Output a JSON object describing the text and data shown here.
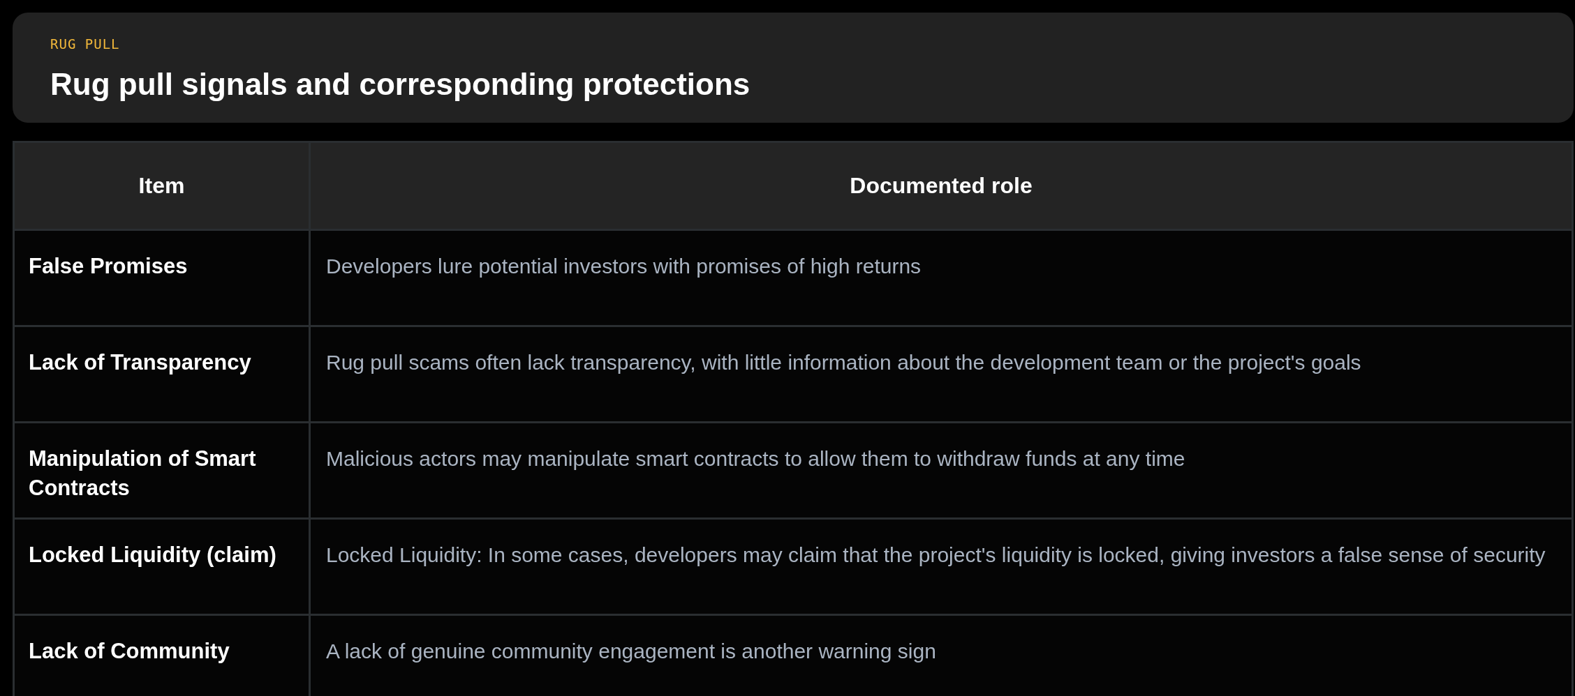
{
  "header": {
    "eyebrow": "RUG PULL",
    "title": "Rug pull signals and corresponding protections"
  },
  "table": {
    "columns": [
      "Item",
      "Documented role"
    ],
    "rows": [
      {
        "item": "False Promises",
        "role": "Developers lure potential investors with promises of high returns"
      },
      {
        "item": "Lack of Transparency",
        "role": "Rug pull scams often lack transparency, with little information about the development team or the project's goals"
      },
      {
        "item": "Manipulation of Smart Contracts",
        "role": "Malicious actors may manipulate smart contracts to allow them to withdraw funds at any time"
      },
      {
        "item": "Locked Liquidity (claim)",
        "role": "Locked Liquidity: In some cases, developers may claim that the project's liquidity is locked, giving investors a false sense of security"
      },
      {
        "item": "Lack of Community",
        "role": "A lack of genuine community engagement is another warning sign"
      }
    ]
  }
}
